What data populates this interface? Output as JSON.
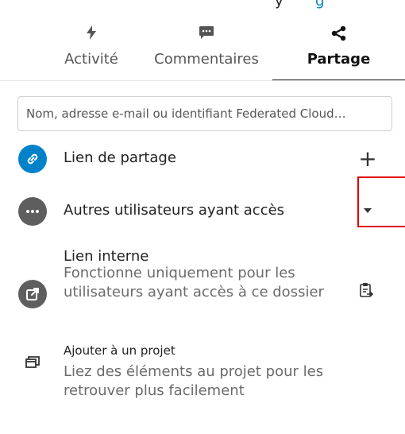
{
  "page": {
    "top_text_partial": "y",
    "top_text_accent": "g"
  },
  "tabs": [
    {
      "label": "Activité",
      "icon": "activity-icon",
      "active": false
    },
    {
      "label": "Commentaires",
      "icon": "comment-icon",
      "active": false
    },
    {
      "label": "Partage",
      "icon": "share-icon",
      "active": true
    }
  ],
  "search": {
    "placeholder": "Nom, adresse e-mail ou identifiant Federated Cloud…",
    "value": ""
  },
  "share_link": {
    "title": "Lien de partage",
    "action": "+",
    "icon": "link-icon"
  },
  "others_with_access": {
    "title": "Autres utilisateurs ayant accès",
    "icon": "more-icon",
    "action_icon": "caret-down-icon"
  },
  "internal_link": {
    "title": "Lien interne",
    "subtitle": "Fonctionne uniquement pour les utilisateurs ayant accès à ce dossier",
    "icon": "external-link-icon",
    "action_icon": "clipboard-icon"
  },
  "project": {
    "title": "Ajouter à un projet",
    "subtitle": "Liez des éléments au projet pour les retrouver plus facilement",
    "icon": "project-icon"
  },
  "colors": {
    "accent": "#0082c9",
    "grey_avatar": "#5e5e5e",
    "highlight": "#e00000"
  }
}
